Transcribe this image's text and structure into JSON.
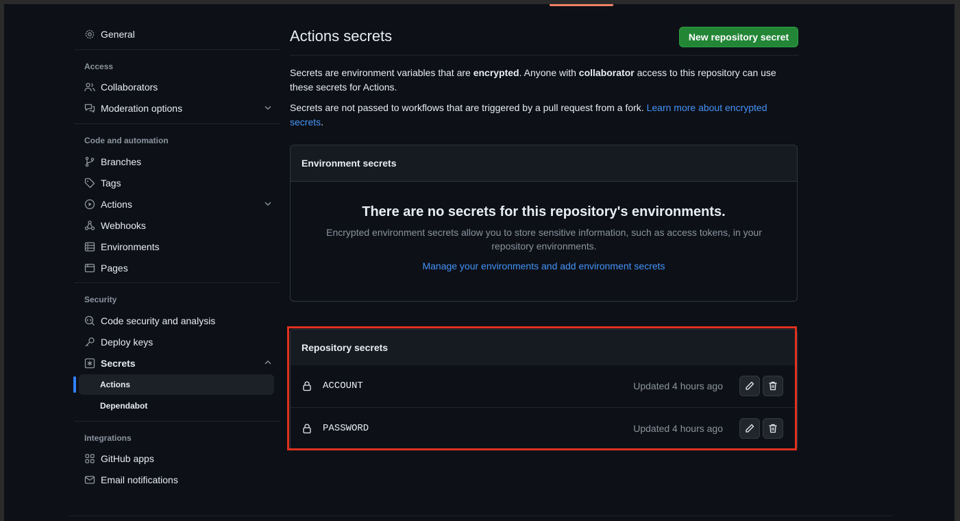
{
  "sidebar": {
    "general": "General",
    "sections": {
      "access": "Access",
      "code_automation": "Code and automation",
      "security": "Security",
      "integrations": "Integrations"
    },
    "items": {
      "collaborators": "Collaborators",
      "moderation": "Moderation options",
      "branches": "Branches",
      "tags": "Tags",
      "actions": "Actions",
      "webhooks": "Webhooks",
      "environments": "Environments",
      "pages": "Pages",
      "code_security": "Code security and analysis",
      "deploy_keys": "Deploy keys",
      "secrets": "Secrets",
      "secrets_actions": "Actions",
      "secrets_dependabot": "Dependabot",
      "github_apps": "GitHub apps",
      "email_notifications": "Email notifications"
    }
  },
  "main": {
    "title": "Actions secrets",
    "new_secret_button": "New repository secret",
    "intro": {
      "p1_a": "Secrets are environment variables that are ",
      "p1_b": "encrypted",
      "p1_c": ". Anyone with ",
      "p1_d": "collaborator",
      "p1_e": " access to this repository can use these secrets for Actions.",
      "p2_a": "Secrets are not passed to workflows that are triggered by a pull request from a fork. ",
      "p2_link": "Learn more about encrypted secrets",
      "p2_b": "."
    },
    "env_secrets": {
      "header": "Environment secrets",
      "empty_title": "There are no secrets for this repository's environments.",
      "empty_text": "Encrypted environment secrets allow you to store sensitive information, such as access tokens, in your repository environments.",
      "manage_link": "Manage your environments and add environment secrets"
    },
    "repo_secrets": {
      "header": "Repository secrets",
      "rows": [
        {
          "name": "ACCOUNT",
          "updated": "Updated 4 hours ago"
        },
        {
          "name": "PASSWORD",
          "updated": "Updated 4 hours ago"
        }
      ]
    }
  },
  "colors": {
    "background": "#0d1117",
    "accent_green": "#238636",
    "link_blue": "#4493f8",
    "highlight_red": "#e0301e",
    "active_indicator": "#2f81f7"
  }
}
